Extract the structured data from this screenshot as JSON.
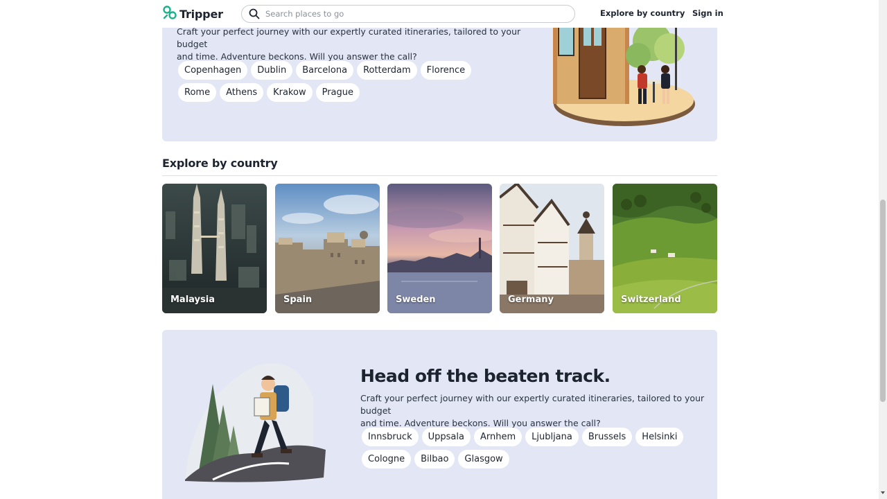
{
  "header": {
    "brand": "Tripper",
    "search_placeholder": "Search places to go",
    "nav": {
      "explore": "Explore by country",
      "signin": "Sign in"
    }
  },
  "hero_top": {
    "description_line1": "Craft your perfect journey with our expertly curated itineraries, tailored to your budget",
    "description_line2": "and time. Adventure beckons. Will you answer the call?",
    "cities": [
      "Copenhagen",
      "Dublin",
      "Barcelona",
      "Rotterdam",
      "Florence",
      "Rome",
      "Athens",
      "Krakow",
      "Prague"
    ]
  },
  "explore": {
    "title": "Explore by country",
    "countries": [
      "Malaysia",
      "Spain",
      "Sweden",
      "Germany",
      "Switzerland"
    ]
  },
  "hero_bottom": {
    "title": "Head off the beaten track.",
    "description_line1": "Craft your perfect journey with our expertly curated itineraries, tailored to your budget",
    "description_line2": "and time. Adventure beckons. Will you answer the call?",
    "cities": [
      "Innsbruck",
      "Uppsala",
      "Arnhem",
      "Ljubljana",
      "Brussels",
      "Helsinki",
      "Cologne",
      "Bilbao",
      "Glasgow"
    ]
  },
  "colors": {
    "accent": "#19b38a",
    "card_bg": "#e3e7f5",
    "text": "#1d2430"
  }
}
